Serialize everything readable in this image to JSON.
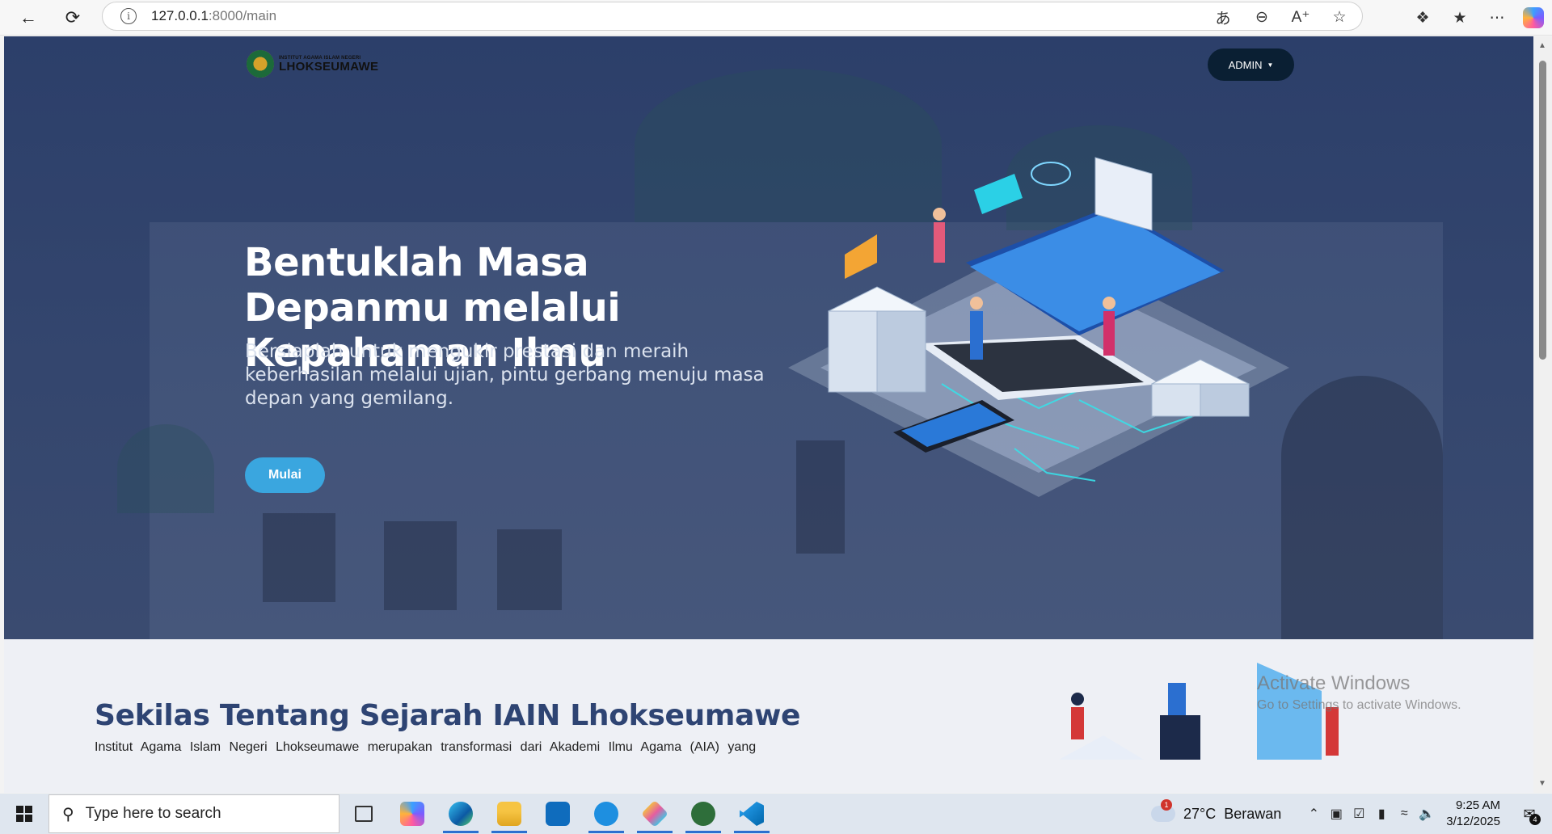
{
  "browser": {
    "url_host": "127.0.0.1",
    "url_rest": ":8000/main",
    "icons": [
      "back-icon",
      "reload-icon",
      "info-icon",
      "translate-icon",
      "zoom-out-icon",
      "read-aloud-icon",
      "favorite-star-icon",
      "extensions-icon",
      "favorites-icon",
      "more-icon",
      "copilot-icon"
    ]
  },
  "site": {
    "logo": {
      "small": "INSTITUT AGAMA ISLAM NEGERI",
      "big": "LHOKSEUMAWE"
    },
    "admin_label": "ADMIN",
    "hero": {
      "headline": "Bentuklah Masa Depanmu melalui Kepahaman Ilmu",
      "subline": "Bersiaplah untuk mengukir prestasi dan meraih keberhasilan melalui ujian, pintu gerbang menuju masa depan yang gemilang.",
      "cta": "Mulai"
    },
    "about": {
      "title": "Sekilas Tentang Sejarah IAIN Lhokseumawe",
      "text": "Institut Agama Islam Negeri Lhokseumawe merupakan transformasi dari Akademi Ilmu Agama (AIA) yang"
    },
    "colors": {
      "hero_bg": "#34466e",
      "cta": "#3aa6df",
      "admin_bg": "#0a1f33",
      "title": "#2e4473"
    }
  },
  "watermark": {
    "line1": "Activate Windows",
    "line2": "Go to Settings to activate Windows."
  },
  "taskbar": {
    "search_placeholder": "Type here to search",
    "apps": [
      "task-view-icon",
      "copilot-app-icon",
      "edge-icon",
      "file-explorer-icon",
      "outlook-icon",
      "app-blue-icon",
      "app-diamond-icon",
      "app-hs-icon",
      "vscode-icon"
    ],
    "weather": {
      "temp": "27°C",
      "desc": "Berawan",
      "alert_count": "1"
    },
    "time": "9:25 AM",
    "date": "3/12/2025",
    "notifications": "4"
  }
}
